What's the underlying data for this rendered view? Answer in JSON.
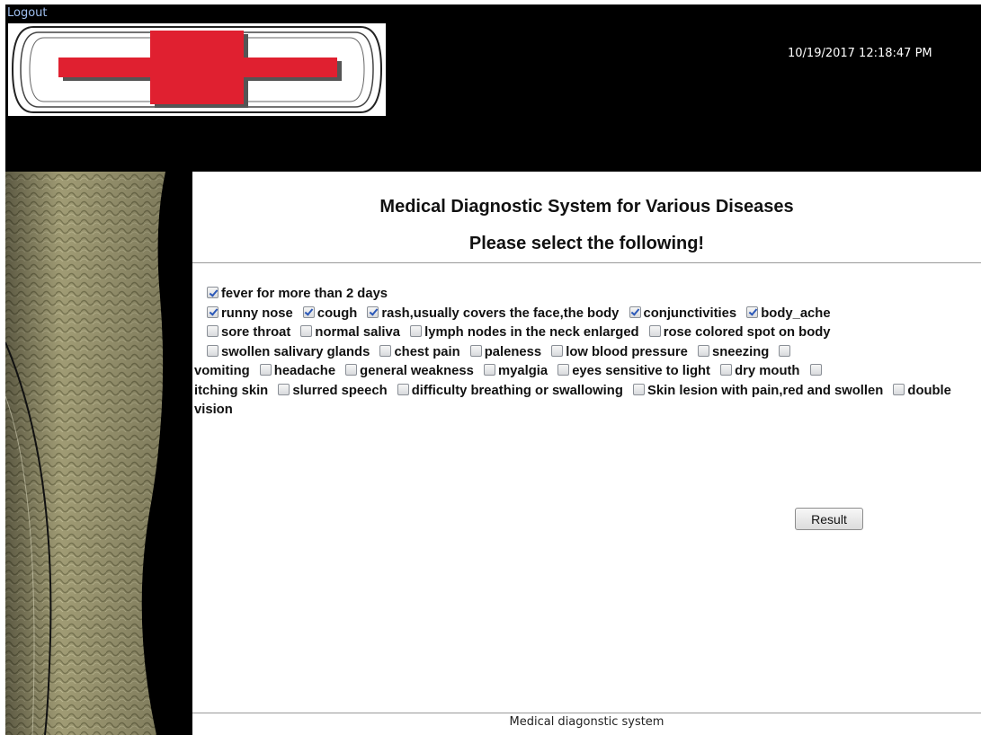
{
  "header": {
    "logout_label": "Logout",
    "datetime": "10/19/2017 12:18:47 PM",
    "logo_icon": "red-cross-logo",
    "colors": {
      "background": "#000000",
      "cross": "#e02030",
      "link": "#9fbfef"
    }
  },
  "main": {
    "title": "Medical Diagnostic System for Various Diseases",
    "subtitle": "Please select the following!",
    "symptoms": [
      {
        "label": "fever for more than 2 days",
        "checked": true
      },
      {
        "label": "runny nose",
        "checked": true
      },
      {
        "label": "cough",
        "checked": true
      },
      {
        "label": "rash,usually covers the face,the body",
        "checked": true
      },
      {
        "label": "conjunctivities",
        "checked": true
      },
      {
        "label": "body_ache",
        "checked": true
      },
      {
        "label": "sore throat",
        "checked": false
      },
      {
        "label": "normal saliva",
        "checked": false
      },
      {
        "label": "lymph nodes in the neck enlarged",
        "checked": false
      },
      {
        "label": "rose colored spot on body",
        "checked": false
      },
      {
        "label": "swollen salivary glands",
        "checked": false
      },
      {
        "label": "chest pain",
        "checked": false
      },
      {
        "label": "paleness",
        "checked": false
      },
      {
        "label": "low blood pressure",
        "checked": false
      },
      {
        "label": "sneezing",
        "checked": false
      },
      {
        "label": "vomiting",
        "checked": false
      },
      {
        "label": "headache",
        "checked": false
      },
      {
        "label": "general weakness",
        "checked": false
      },
      {
        "label": "myalgia",
        "checked": false
      },
      {
        "label": "eyes sensitive to light",
        "checked": false
      },
      {
        "label": "dry mouth",
        "checked": false
      },
      {
        "label": "itching skin",
        "checked": false
      },
      {
        "label": "slurred speech",
        "checked": false
      },
      {
        "label": "difficulty breathing or swallowing",
        "checked": false
      },
      {
        "label": "Skin lesion with pain,red and swollen",
        "checked": false
      },
      {
        "label": "double vision",
        "checked": false
      }
    ],
    "result_label": "Result"
  },
  "footer": {
    "text": "Medical diagonstic system"
  }
}
